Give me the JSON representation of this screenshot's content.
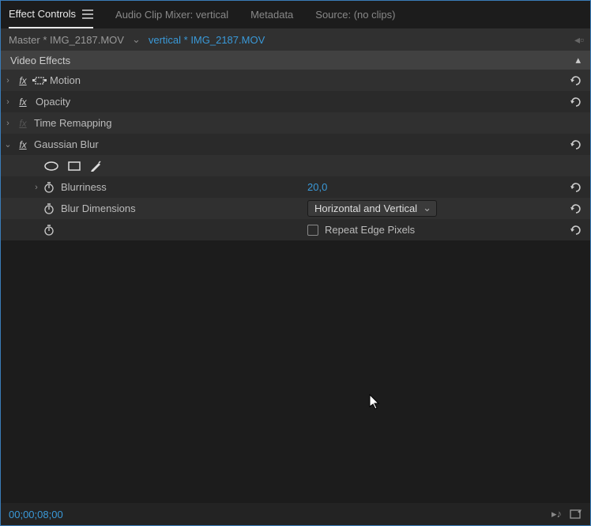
{
  "tabs": {
    "effect_controls": "Effect Controls",
    "audio_mixer": "Audio Clip Mixer: vertical",
    "metadata": "Metadata",
    "source": "Source: (no clips)"
  },
  "file_path": {
    "master": "Master * IMG_2187.MOV",
    "clip": "vertical * IMG_2187.MOV"
  },
  "section": {
    "video_effects": "Video Effects"
  },
  "effects": {
    "motion": {
      "label": "Motion"
    },
    "opacity": {
      "label": "Opacity"
    },
    "time_remapping": {
      "label": "Time Remapping"
    },
    "gaussian_blur": {
      "label": "Gaussian Blur"
    }
  },
  "gaussian": {
    "blurriness": {
      "label": "Blurriness",
      "value": "20,0"
    },
    "blur_dimensions": {
      "label": "Blur Dimensions",
      "value": "Horizontal and Vertical"
    },
    "repeat_edge": {
      "label": "Repeat Edge Pixels"
    }
  },
  "timecode": "00;00;08;00",
  "colors": {
    "accent": "#3a99d8",
    "bg": "#1c1c1c"
  }
}
